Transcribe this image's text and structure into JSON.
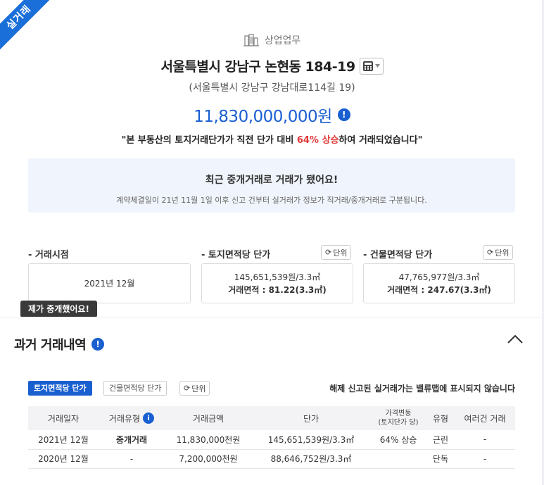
{
  "badge": "실거래",
  "category": "상업업무",
  "address": "서울특별시 강남구 논현동 184-19",
  "road_address": "(서울특별시 강남구 강남대로114길 19)",
  "price": "11,830,000,000원",
  "quote": {
    "before": "\"본 부동산의 토지거래단가가 직전 단가 대비 ",
    "highlight": "64% 상승",
    "after": "하여 거래되었습니다\""
  },
  "notice": {
    "title": "최근 중개거래로 거래가 됐어요!",
    "subtitle": "계약체결일이 21년 11월 1일 이후 신고 건부터 실거래가 정보가 직거래/중개거래로 구분됩니다."
  },
  "summary": {
    "date_label": "- 거래시점",
    "date_value": "2021년 12월",
    "land_label": "- 토지면적당 단가",
    "land_price": "145,651,539원/3.3㎡",
    "land_area": "거래면적 : 81.22(3.3㎡)",
    "building_label": "- 건물면적당 단가",
    "building_price": "47,765,977원/3.3㎡",
    "building_area": "거래면적 : 247.67(3.3㎡)",
    "unit_button": "단위"
  },
  "tooltip": "제가 중개했어요!",
  "history": {
    "title": "과거 거래내역",
    "tabs": [
      "토지면적당 단가",
      "건물면적당 단가"
    ],
    "unit_button": "단위",
    "note": "해제 신고된 실거래가는 밸류맵에 표시되지 않습니다",
    "columns": [
      "거래일자",
      "거래유형",
      "거래금액",
      "단가",
      "가격변동",
      "(토지단가 당)",
      "유형",
      "여러건 거래"
    ],
    "rows": [
      {
        "date": "2021년 12월",
        "type": "중개거래",
        "amount": "11,830,000천원",
        "unit_price": "145,651,539원/3.3㎡",
        "change": "64% 상승",
        "kind": "근린",
        "multi": "-"
      },
      {
        "date": "2020년 12월",
        "type": "-",
        "amount": "7,200,000천원",
        "unit_price": "88,646,752원/3.3㎡",
        "change": "",
        "kind": "단독",
        "multi": "-"
      }
    ]
  },
  "colors": {
    "accent": "#1a5fd0",
    "ribbon": "#1a6fd8",
    "rise": "#e03a3a",
    "notice_bg": "#f0f4fc"
  }
}
